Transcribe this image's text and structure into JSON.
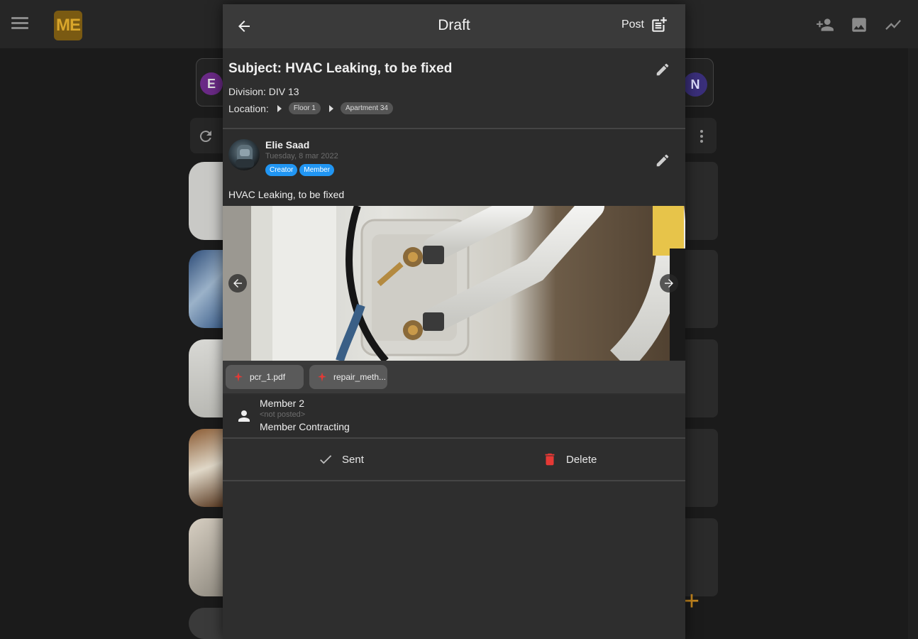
{
  "app": {
    "logo_text": "ME",
    "bg_avatars": [
      "E",
      "N"
    ],
    "fab_label": "+"
  },
  "dialog": {
    "title": "Draft",
    "post_label": "Post",
    "subject": "Subject: HVAC Leaking, to be fixed",
    "division": "Division: DIV 13",
    "location_label": "Location:",
    "location_path": [
      "Floor 1",
      "Apartment 34"
    ]
  },
  "post": {
    "author": "Elie Saad",
    "date": "Tuesday, 8 mar 2022",
    "badges": [
      "Creator",
      "Member"
    ],
    "text": "HVAC Leaking, to be fixed",
    "attachments": [
      "pcr_1.pdf",
      "repair_meth..."
    ]
  },
  "recipient": {
    "name": "Member 2",
    "status": "<not posted>",
    "company": "Member Contracting"
  },
  "actions": {
    "sent_label": "Sent",
    "delete_label": "Delete"
  },
  "colors": {
    "accent_blue": "#2196f3",
    "delete_red": "#e53935",
    "pdf_red": "#e53935",
    "logo_bg": "#7a5a12",
    "logo_text": "#d9a62b",
    "fab": "#c98a1f"
  }
}
